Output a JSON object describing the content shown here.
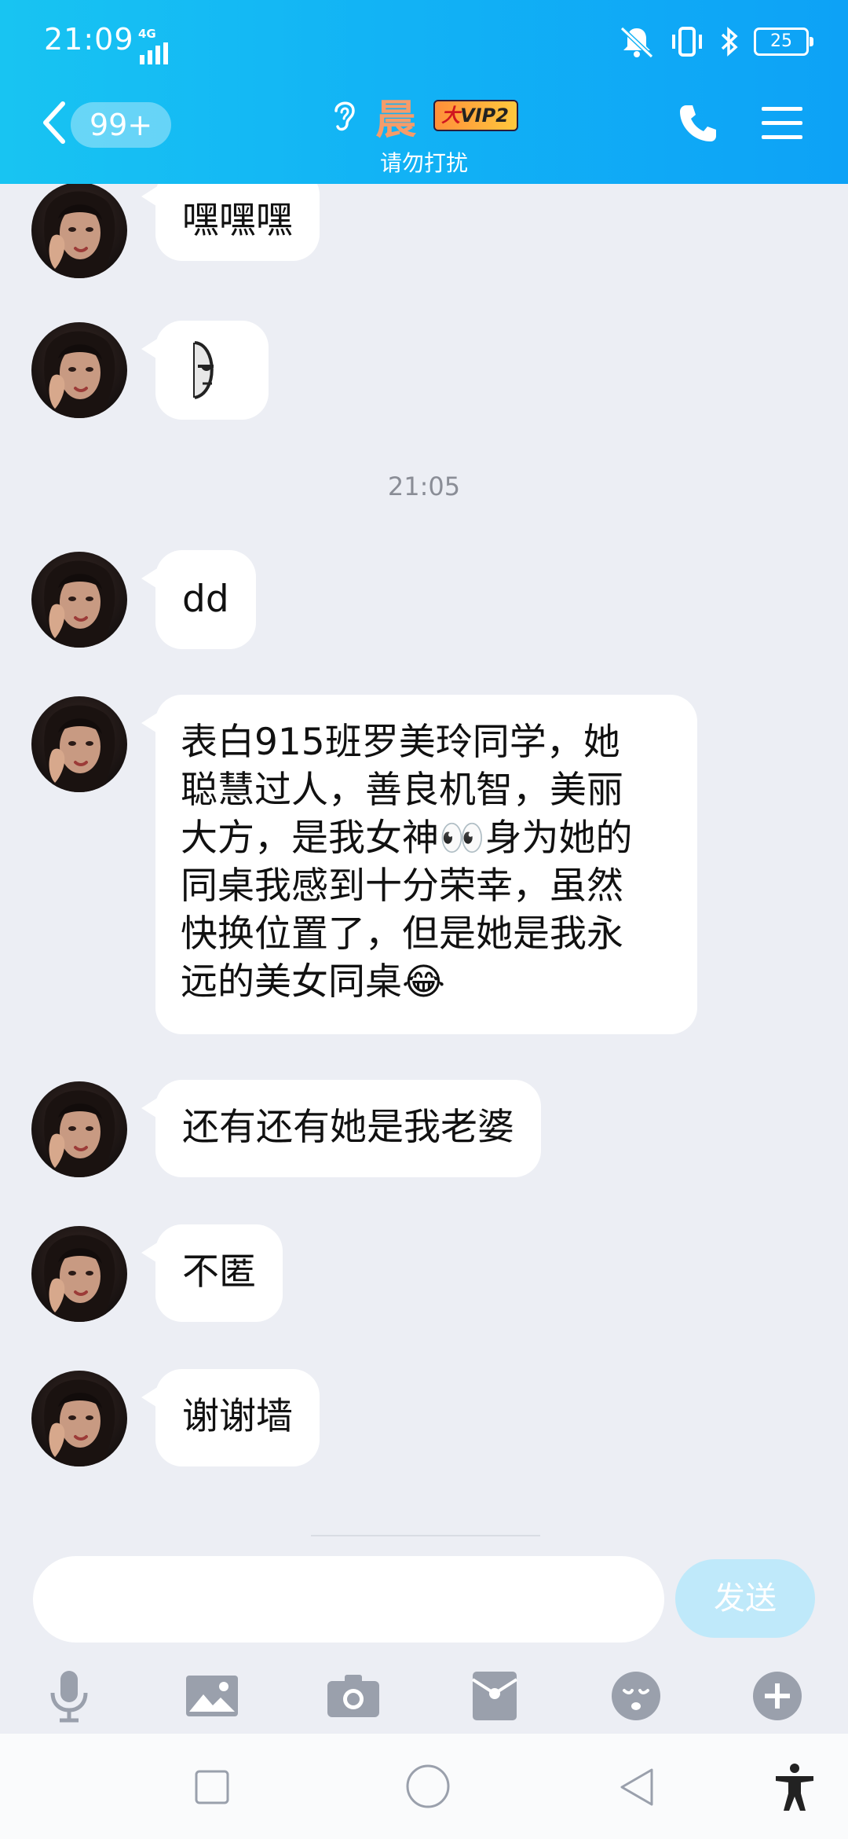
{
  "status_bar": {
    "time": "21:09",
    "network": "4G",
    "battery": "25"
  },
  "header": {
    "unread_badge": "99+",
    "contact_name": "晨",
    "vip_badge": "VIP2",
    "vip_prefix": "大",
    "subtitle": "请勿打扰"
  },
  "messages": [
    {
      "type": "text",
      "text": "嘿嘿嘿"
    },
    {
      "type": "sticker",
      "icon": "half-face-sticker-icon"
    },
    {
      "type": "timestamp",
      "text": "21:05"
    },
    {
      "type": "text",
      "text": "dd"
    },
    {
      "type": "text",
      "lines": [
        "表白915班罗美玲同学，她",
        "聪慧过人，善良机智，美丽",
        "大方，是我女神👀身为她的",
        "同桌我感到十分荣幸，虽然",
        "快换位置了，但是她是我永",
        "远的美女同桌😂"
      ]
    },
    {
      "type": "text",
      "text": "还有还有她是我老婆"
    },
    {
      "type": "text",
      "text": "不匿"
    },
    {
      "type": "text",
      "text": "谢谢墙"
    }
  ],
  "composer": {
    "input_value": "",
    "send_label": "发送"
  },
  "toolbar_icons": [
    "microphone-icon",
    "image-icon",
    "camera-icon",
    "red-packet-icon",
    "emoji-icon",
    "plus-icon"
  ],
  "colors": {
    "header_gradient_start": "#18c4f2",
    "header_gradient_end": "#0da2f6",
    "chat_background": "#eceef4",
    "bubble": "#ffffff",
    "send_button_disabled": "#bfe9fa",
    "icon_gray": "#9aa0ac"
  }
}
